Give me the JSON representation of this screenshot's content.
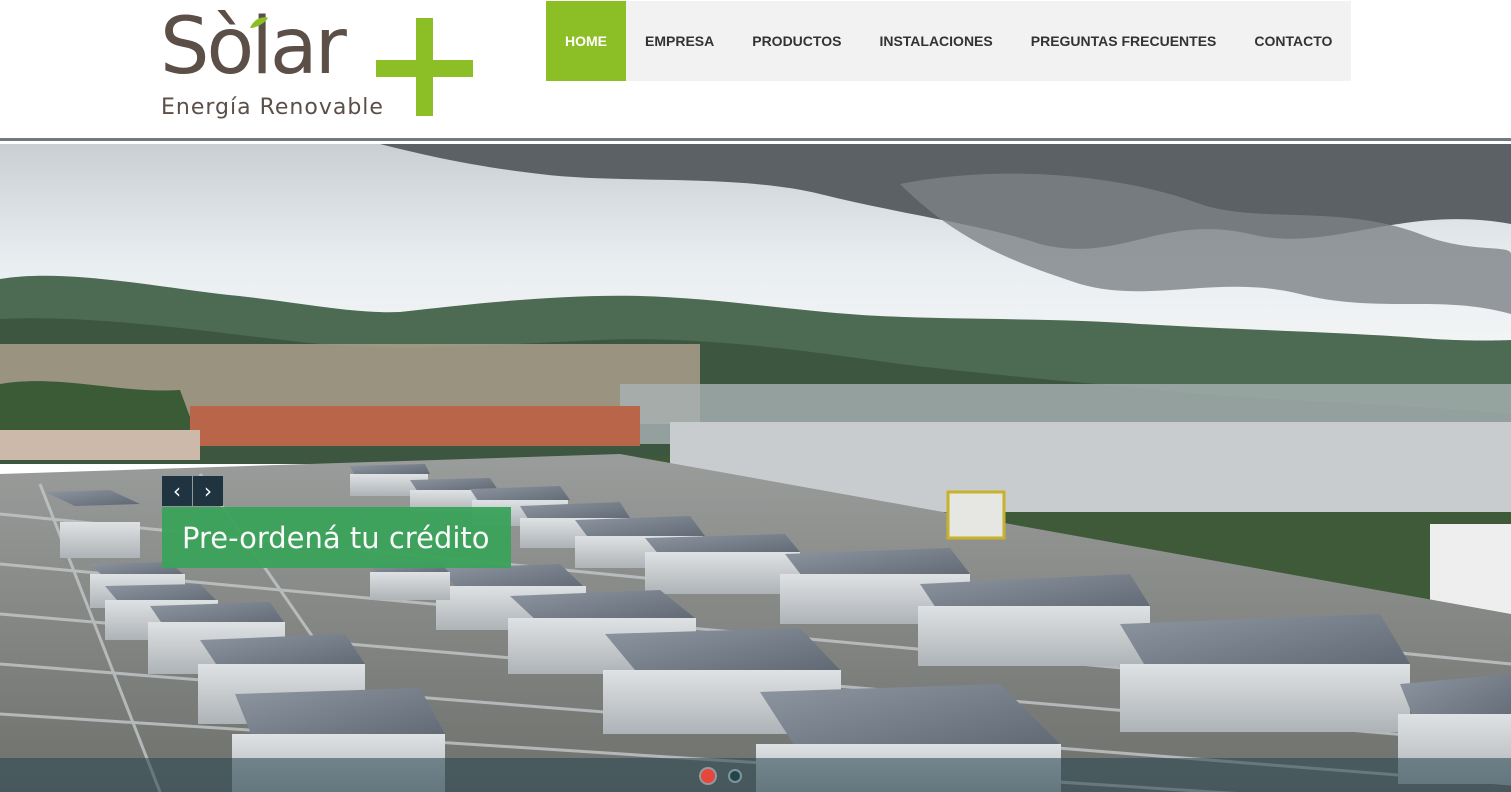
{
  "brand": {
    "name": "Solar+",
    "name_prefix": "Sòlar",
    "tagline": "Energía Renovable",
    "color_green": "#8cbf26",
    "color_brown": "#5b4f48"
  },
  "nav": {
    "items": [
      {
        "label": "HOME",
        "active": true
      },
      {
        "label": "EMPRESA",
        "active": false
      },
      {
        "label": "PRODUCTOS",
        "active": false
      },
      {
        "label": "INSTALACIONES",
        "active": false
      },
      {
        "label": "PREGUNTAS FRECUENTES",
        "active": false
      },
      {
        "label": "CONTACTO",
        "active": false
      }
    ]
  },
  "slider": {
    "prev_icon": "chevron-left-icon",
    "next_icon": "chevron-right-icon",
    "prev_glyph": "‹",
    "next_glyph": "›",
    "caption": "Pre-ordená tu crédito",
    "caption_color": "#3aa35b",
    "slide_count": 2,
    "current_slide": 1
  }
}
